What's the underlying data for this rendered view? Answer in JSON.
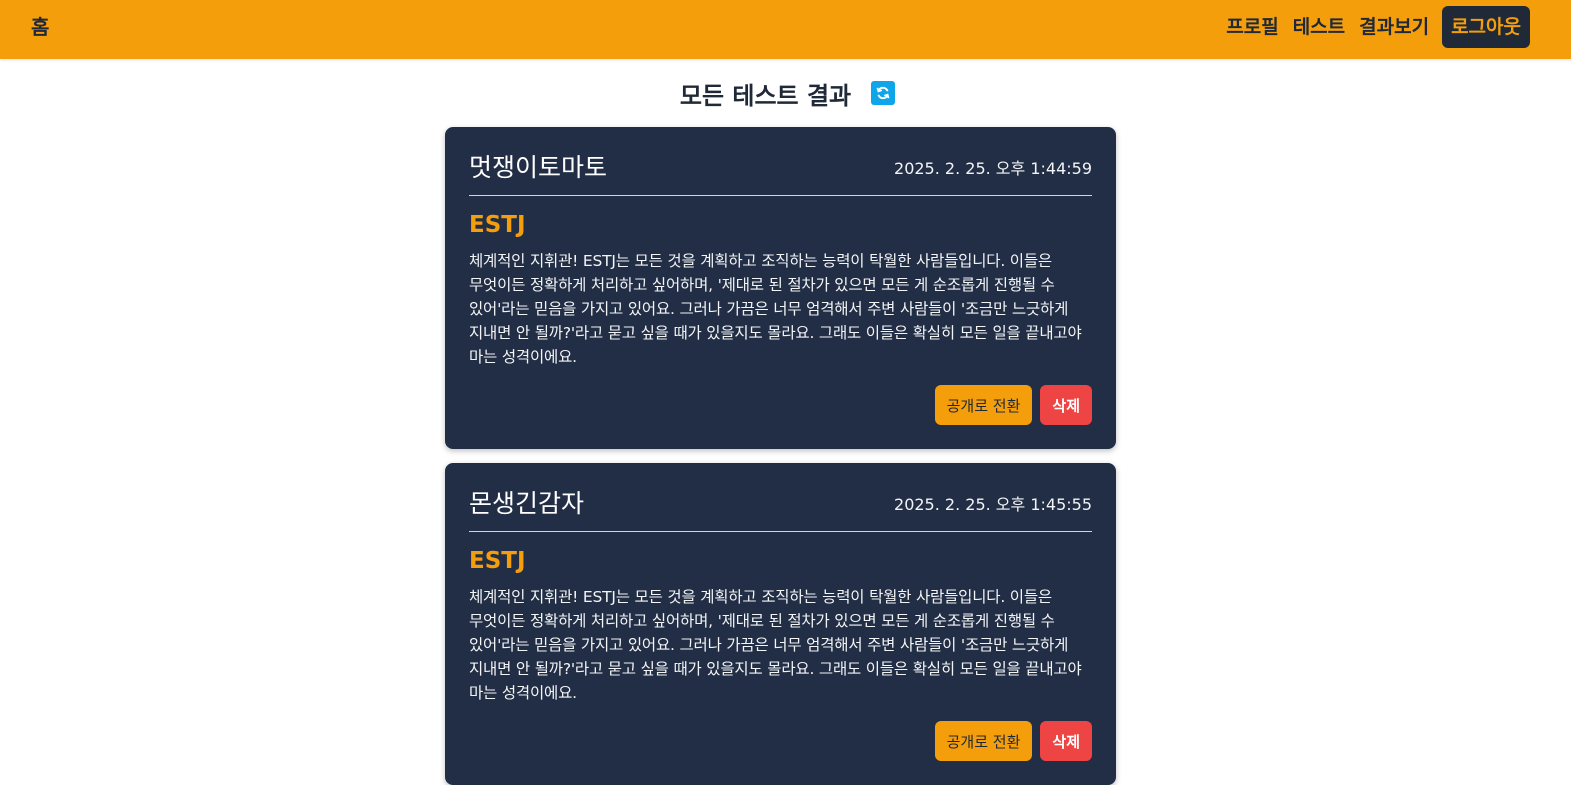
{
  "nav": {
    "home_label": "홈",
    "links": [
      "프로필",
      "테스트",
      "결과보기"
    ],
    "logout_label": "로그아웃"
  },
  "page": {
    "title": "모든 테스트 결과",
    "refresh_icon": "refresh-icon"
  },
  "colors": {
    "nav_bg": "#f59e0b",
    "card_bg": "#222e45",
    "accent": "#f59e0b",
    "danger": "#ef4444",
    "refresh": "#0ea5e9"
  },
  "results": [
    {
      "name": "멋쟁이토마토",
      "date": "2025. 2. 25. 오후 1:44:59",
      "type": "ESTJ",
      "description": "체계적인 지휘관! ESTJ는 모든 것을 계획하고 조직하는 능력이 탁월한 사람들입니다. 이들은 무엇이든 정확하게 처리하고 싶어하며, '제대로 된 절차가 있으면 모든 게 순조롭게 진행될 수 있어'라는 믿음을 가지고 있어요. 그러나 가끔은 너무 엄격해서 주변 사람들이 '조금만 느긋하게 지내면 안 될까?'라고 묻고 싶을 때가 있을지도 몰라요. 그래도 이들은 확실히 모든 일을 끝내고야 마는 성격이에요.",
      "public_label": "공개로 전환",
      "delete_label": "삭제"
    },
    {
      "name": "몬생긴감자",
      "date": "2025. 2. 25. 오후 1:45:55",
      "type": "ESTJ",
      "description": "체계적인 지휘관! ESTJ는 모든 것을 계획하고 조직하는 능력이 탁월한 사람들입니다. 이들은 무엇이든 정확하게 처리하고 싶어하며, '제대로 된 절차가 있으면 모든 게 순조롭게 진행될 수 있어'라는 믿음을 가지고 있어요. 그러나 가끔은 너무 엄격해서 주변 사람들이 '조금만 느긋하게 지내면 안 될까?'라고 묻고 싶을 때가 있을지도 몰라요. 그래도 이들은 확실히 모든 일을 끝내고야 마는 성격이에요.",
      "public_label": "공개로 전환",
      "delete_label": "삭제"
    }
  ]
}
